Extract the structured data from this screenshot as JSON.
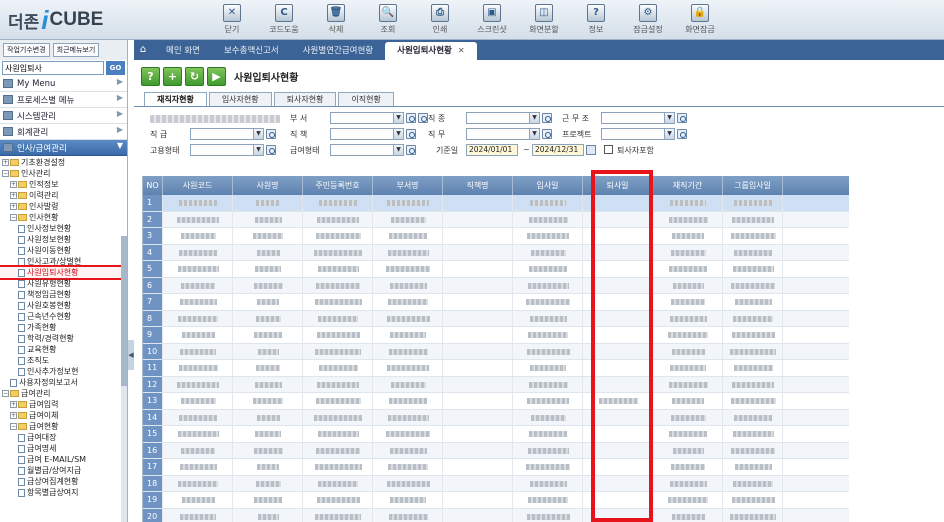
{
  "app": {
    "brand_prefix": "더존",
    "brand_letter": "i",
    "brand_name": "CUBE"
  },
  "toolbar": [
    {
      "label": "닫기",
      "icon": "close-icon",
      "glyph": "✕"
    },
    {
      "label": "코드도움",
      "icon": "code-help-icon",
      "glyph": "C"
    },
    {
      "label": "삭제",
      "icon": "delete-icon",
      "glyph": "🗑"
    },
    {
      "label": "조회",
      "icon": "search-icon",
      "glyph": "🔍"
    },
    {
      "label": "인쇄",
      "icon": "print-icon",
      "glyph": "⎙"
    },
    {
      "label": "스크린샷",
      "icon": "screenshot-icon",
      "glyph": "▣"
    },
    {
      "label": "화면분할",
      "icon": "split-screen-icon",
      "glyph": "◫"
    },
    {
      "label": "정보",
      "icon": "info-icon",
      "glyph": "?"
    },
    {
      "label": "잠금설정",
      "icon": "lock-settings-icon",
      "glyph": "⚙"
    },
    {
      "label": "화면잠금",
      "icon": "screen-lock-icon",
      "glyph": "🔒"
    }
  ],
  "left": {
    "btn_change": "작업기수변경",
    "btn_recent": "최근메뉴보기",
    "search_value": "사원입퇴사",
    "search_go": "GO",
    "menus": [
      {
        "label": "My Menu",
        "active": false
      },
      {
        "label": "프로세스별 메뉴",
        "active": false
      },
      {
        "label": "시스템관리",
        "active": false
      },
      {
        "label": "회계관리",
        "active": false
      },
      {
        "label": "인사/급여관리",
        "active": true
      }
    ],
    "tree": [
      {
        "label": "기초환경설정",
        "indent": 1,
        "type": "folder",
        "ex": "+"
      },
      {
        "label": "인사관리",
        "indent": 1,
        "type": "folder",
        "ex": "−"
      },
      {
        "label": "인적정보",
        "indent": 2,
        "type": "folder",
        "ex": "+"
      },
      {
        "label": "이력관리",
        "indent": 2,
        "type": "folder",
        "ex": "+"
      },
      {
        "label": "인사발령",
        "indent": 2,
        "type": "folder",
        "ex": "+"
      },
      {
        "label": "인사현황",
        "indent": 2,
        "type": "folder",
        "ex": "−"
      },
      {
        "label": "인사정보현황",
        "indent": 3,
        "type": "doc"
      },
      {
        "label": "사원정보현황",
        "indent": 3,
        "type": "doc"
      },
      {
        "label": "사원이동현황",
        "indent": 3,
        "type": "doc"
      },
      {
        "label": "인사고과/상벌현",
        "indent": 3,
        "type": "doc"
      },
      {
        "label": "사원입퇴사현황",
        "indent": 3,
        "type": "doc",
        "highlight": true
      },
      {
        "label": "사원유형현황",
        "indent": 3,
        "type": "doc"
      },
      {
        "label": "책정임금현황",
        "indent": 3,
        "type": "doc"
      },
      {
        "label": "사원호봉현황",
        "indent": 3,
        "type": "doc"
      },
      {
        "label": "근속년수현황",
        "indent": 3,
        "type": "doc"
      },
      {
        "label": "가족현황",
        "indent": 3,
        "type": "doc"
      },
      {
        "label": "학력/경력현황",
        "indent": 3,
        "type": "doc"
      },
      {
        "label": "교육현황",
        "indent": 3,
        "type": "doc"
      },
      {
        "label": "조직도",
        "indent": 3,
        "type": "doc"
      },
      {
        "label": "인사추가정보현",
        "indent": 3,
        "type": "doc"
      },
      {
        "label": "사용자정의보고서",
        "indent": 2,
        "type": "doc"
      },
      {
        "label": "급여관리",
        "indent": 1,
        "type": "folder",
        "ex": "−"
      },
      {
        "label": "급여입력",
        "indent": 2,
        "type": "folder",
        "ex": "+"
      },
      {
        "label": "급여이체",
        "indent": 2,
        "type": "folder",
        "ex": "+"
      },
      {
        "label": "급여현황",
        "indent": 2,
        "type": "folder",
        "ex": "−"
      },
      {
        "label": "급여대장",
        "indent": 3,
        "type": "doc"
      },
      {
        "label": "급여명세",
        "indent": 3,
        "type": "doc"
      },
      {
        "label": "급여 E-MAIL/SM",
        "indent": 3,
        "type": "doc"
      },
      {
        "label": "월별급/상여지급",
        "indent": 3,
        "type": "doc"
      },
      {
        "label": "급상여집계현황",
        "indent": 3,
        "type": "doc"
      },
      {
        "label": "항목별급상여지",
        "indent": 3,
        "type": "doc"
      }
    ]
  },
  "tabs": [
    {
      "label": "메인 화면",
      "active": false
    },
    {
      "label": "보수총액신고서",
      "active": false
    },
    {
      "label": "사원별연간급여현황",
      "active": false
    },
    {
      "label": "사원입퇴사현황",
      "active": true
    }
  ],
  "page": {
    "title": "사원입퇴사현황"
  },
  "subtabs": [
    {
      "label": "재직자현황",
      "active": true
    },
    {
      "label": "입사자현황",
      "active": false
    },
    {
      "label": "퇴사자현황",
      "active": false
    },
    {
      "label": "이직현황",
      "active": false
    }
  ],
  "filters": {
    "dept": "부   서",
    "rank": "직   종",
    "work_type": "근 무 조",
    "grade": "직   급",
    "duty": "직   책",
    "role": "직   무",
    "project": "프로젝트",
    "employ_type": "고용형태",
    "pay_type": "급여형태",
    "base_date": "기준일",
    "date_from": "2024/01/01",
    "tilde": "~",
    "date_to": "2024/12/31",
    "include_retired": "퇴사자포함"
  },
  "grid": {
    "columns": [
      "NO",
      "사원코드",
      "사원명",
      "주민등록번호",
      "부서명",
      "직책명",
      "입사일",
      "퇴사일",
      "재직기간",
      "그룹입사일"
    ],
    "rows": [
      "1",
      "2",
      "3",
      "4",
      "5",
      "6",
      "7",
      "8",
      "9",
      "10",
      "11",
      "12",
      "13",
      "14",
      "15",
      "16",
      "17",
      "18",
      "19",
      "20"
    ]
  },
  "colors": {
    "accent": "#3c6396",
    "highlight": "#e8141c",
    "header": "#6f94c3"
  }
}
